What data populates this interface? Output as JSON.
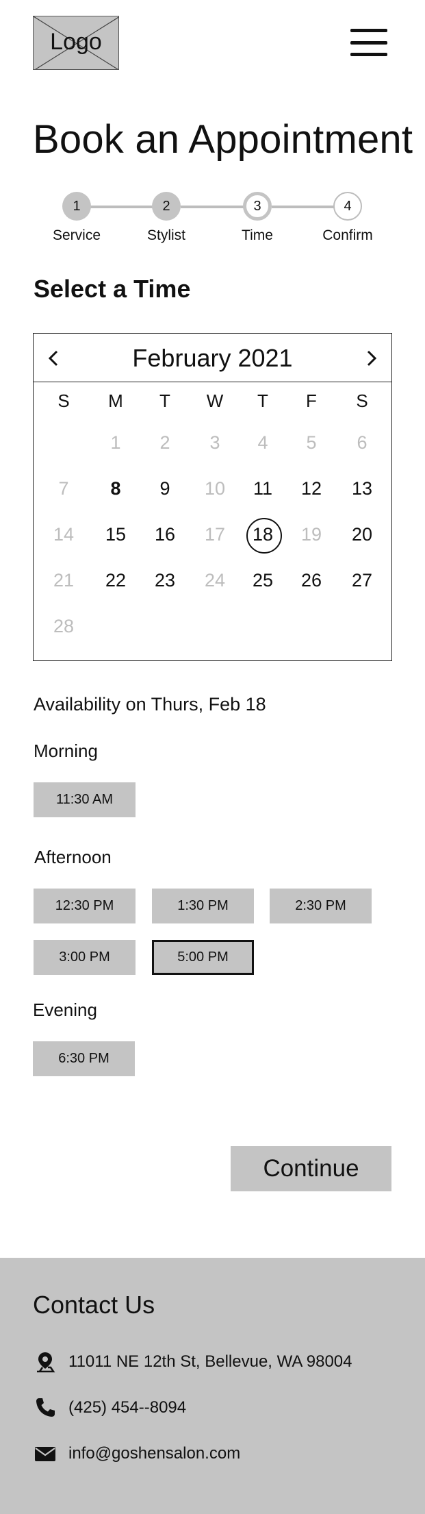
{
  "header": {
    "logo_text": "Logo",
    "menu_icon": "hamburger-menu-icon"
  },
  "page_title": "Book an Appointment",
  "stepper": {
    "steps": [
      {
        "number": "1",
        "label": "Service",
        "state": "done"
      },
      {
        "number": "2",
        "label": "Stylist",
        "state": "done"
      },
      {
        "number": "3",
        "label": "Time",
        "state": "current"
      },
      {
        "number": "4",
        "label": "Confirm",
        "state": "todo"
      }
    ]
  },
  "section_title": "Select a Time",
  "calendar": {
    "month_label": "February 2021",
    "prev_icon": "chevron-left-icon",
    "next_icon": "chevron-right-icon",
    "weekdays": [
      "S",
      "M",
      "T",
      "W",
      "T",
      "F",
      "S"
    ],
    "weeks": [
      [
        {
          "d": ""
        },
        {
          "d": "1",
          "muted": true
        },
        {
          "d": "2",
          "muted": true
        },
        {
          "d": "3",
          "muted": true
        },
        {
          "d": "4",
          "muted": true
        },
        {
          "d": "5",
          "muted": true
        },
        {
          "d": "6",
          "muted": true
        }
      ],
      [
        {
          "d": "7",
          "muted": true
        },
        {
          "d": "8",
          "bold": true
        },
        {
          "d": "9"
        },
        {
          "d": "10",
          "muted": true
        },
        {
          "d": "11"
        },
        {
          "d": "12"
        },
        {
          "d": "13"
        }
      ],
      [
        {
          "d": "14",
          "muted": true
        },
        {
          "d": "15"
        },
        {
          "d": "16"
        },
        {
          "d": "17",
          "muted": true
        },
        {
          "d": "18",
          "selected": true
        },
        {
          "d": "19",
          "muted": true
        },
        {
          "d": "20"
        }
      ],
      [
        {
          "d": "21",
          "muted": true
        },
        {
          "d": "22"
        },
        {
          "d": "23"
        },
        {
          "d": "24",
          "muted": true
        },
        {
          "d": "25"
        },
        {
          "d": "26"
        },
        {
          "d": "27"
        }
      ],
      [
        {
          "d": "28",
          "muted": true
        }
      ]
    ]
  },
  "availability": {
    "title": "Availability on Thurs, Feb 18",
    "periods": [
      {
        "name": "Morning",
        "slots": [
          "11:30 AM"
        ]
      },
      {
        "name": "Afternoon",
        "slots": [
          "12:30 PM",
          "1:30 PM",
          "2:30 PM",
          "3:00 PM",
          "5:00 PM"
        ]
      },
      {
        "name": "Evening",
        "slots": [
          "6:30 PM"
        ]
      }
    ],
    "selected_slot": "5:00 PM"
  },
  "continue_label": "Continue",
  "footer": {
    "title": "Contact Us",
    "address": "11011 NE 12th St, Bellevue, WA 98004",
    "phone": "(425) 454--8094",
    "email": "info@goshensalon.com",
    "icons": [
      "location-pin-icon",
      "phone-icon",
      "email-icon"
    ]
  }
}
